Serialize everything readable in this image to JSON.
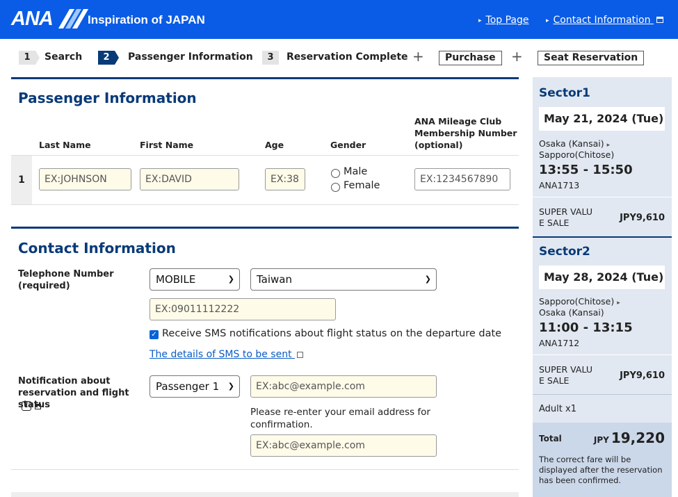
{
  "header": {
    "logo_text": "ANA",
    "tagline": "Inspiration of JAPAN",
    "links": {
      "top_page": "Top Page",
      "contact": "Contact Information"
    }
  },
  "steps": {
    "s1_num": "1",
    "s1_label": "Search",
    "s2_num": "2",
    "s2_label": "Passenger Information",
    "s3_num": "3",
    "s3_label": "Reservation Complete",
    "plus": "+",
    "purchase": "Purchase",
    "seat": "Seat Reservation"
  },
  "passenger": {
    "title": "Passenger Information",
    "headers": {
      "last": "Last Name",
      "first": "First Name",
      "age": "Age",
      "gender": "Gender",
      "mileage": "ANA Mileage Club Membership Number (optional)"
    },
    "row_num": "1",
    "placeholders": {
      "last": "EX:JOHNSON",
      "first": "EX:DAVID",
      "age": "EX:38",
      "mileage": "EX:1234567890"
    },
    "gender_options": [
      "Male",
      "Female"
    ]
  },
  "contact": {
    "title": "Contact Information",
    "tel_label": "Telephone Number (required)",
    "phone_type": "MOBILE",
    "country": "Taiwan",
    "phone_placeholder": "EX:09011112222",
    "sms_checkbox": "Receive SMS notifications about flight status on the departure date",
    "sms_link": "The details of SMS to be sent",
    "notify_label": "Notification about reservation and flight status",
    "passenger_select": "Passenger 1",
    "email_placeholder": "EX:abc@example.com",
    "reenter_text": "Please re-enter your email address for confirmation.",
    "email2_placeholder": "EX:abc@example.com"
  },
  "sidebar": {
    "sector1": {
      "title": "Sector1",
      "date": "May 21, 2024 (Tue)",
      "from": "Osaka (Kansai)",
      "to": "Sapporo(Chitose)",
      "time": "13:55 - 15:50",
      "flight": "ANA1713",
      "fare1": "SUPER VALU",
      "fare2": "E SALE",
      "price": "JPY9,610"
    },
    "sector2": {
      "title": "Sector2",
      "date": "May 28, 2024 (Tue)",
      "from": "Sapporo(Chitose)",
      "to": "Osaka (Kansai)",
      "time": "11:00 - 13:15",
      "flight": "ANA1712",
      "fare1": "SUPER VALU",
      "fare2": "E SALE",
      "price": "JPY9,610"
    },
    "adult": "Adult x1",
    "total_label": "Total",
    "currency": "JPY",
    "total": "19,220",
    "note": "The correct fare will be displayed after the reservation has been confirmed."
  },
  "colors": {
    "header": "#0a5ce6",
    "navy": "#083a78",
    "sidebar": "#e1e8f1",
    "input_bg": "#fffbe9"
  }
}
